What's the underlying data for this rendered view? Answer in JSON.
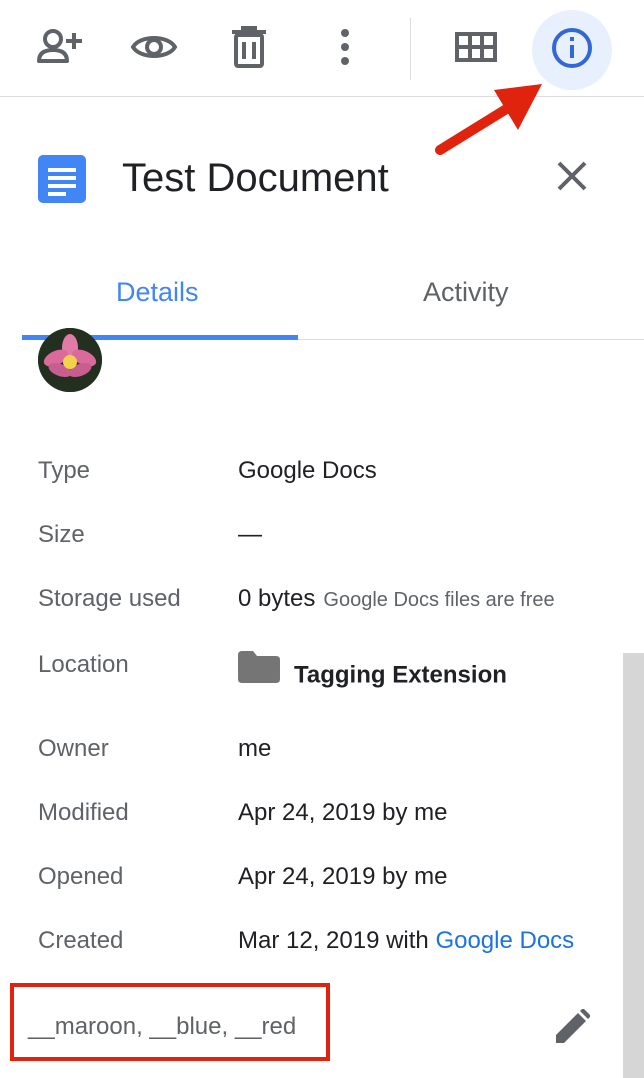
{
  "toolbar": {
    "share_icon": "add-person-icon",
    "preview_icon": "eye-icon",
    "trash_icon": "trash-icon",
    "more_icon": "more-vert-icon",
    "grid_icon": "grid-view-icon",
    "info_icon": "info-icon"
  },
  "colors": {
    "accent": "#4285f4",
    "info_bg": "#e8f0fe",
    "annotation": "#e0230d",
    "link": "#1a73e8",
    "icon_gray": "#5f6368"
  },
  "file": {
    "title": "Test Document",
    "icon": "google-docs-icon"
  },
  "tabs": {
    "details": "Details",
    "activity": "Activity",
    "active": "Details"
  },
  "details": {
    "type": {
      "label": "Type",
      "value": "Google Docs"
    },
    "size": {
      "label": "Size",
      "value": "—"
    },
    "storage": {
      "label": "Storage used",
      "value": "0 bytes",
      "note": "Google Docs files are free"
    },
    "location": {
      "label": "Location",
      "value": "Tagging Extension",
      "icon": "folder-icon"
    },
    "owner": {
      "label": "Owner",
      "value": "me"
    },
    "modified": {
      "label": "Modified",
      "value": "Apr 24, 2019 by me"
    },
    "opened": {
      "label": "Opened",
      "value": "Apr 24, 2019 by me"
    },
    "created": {
      "label": "Created",
      "value_prefix": "Mar 12, 2019 with ",
      "value_link": "Google Docs"
    }
  },
  "tags": {
    "text": "__maroon, __blue, __red",
    "edit_icon": "pencil-icon"
  }
}
